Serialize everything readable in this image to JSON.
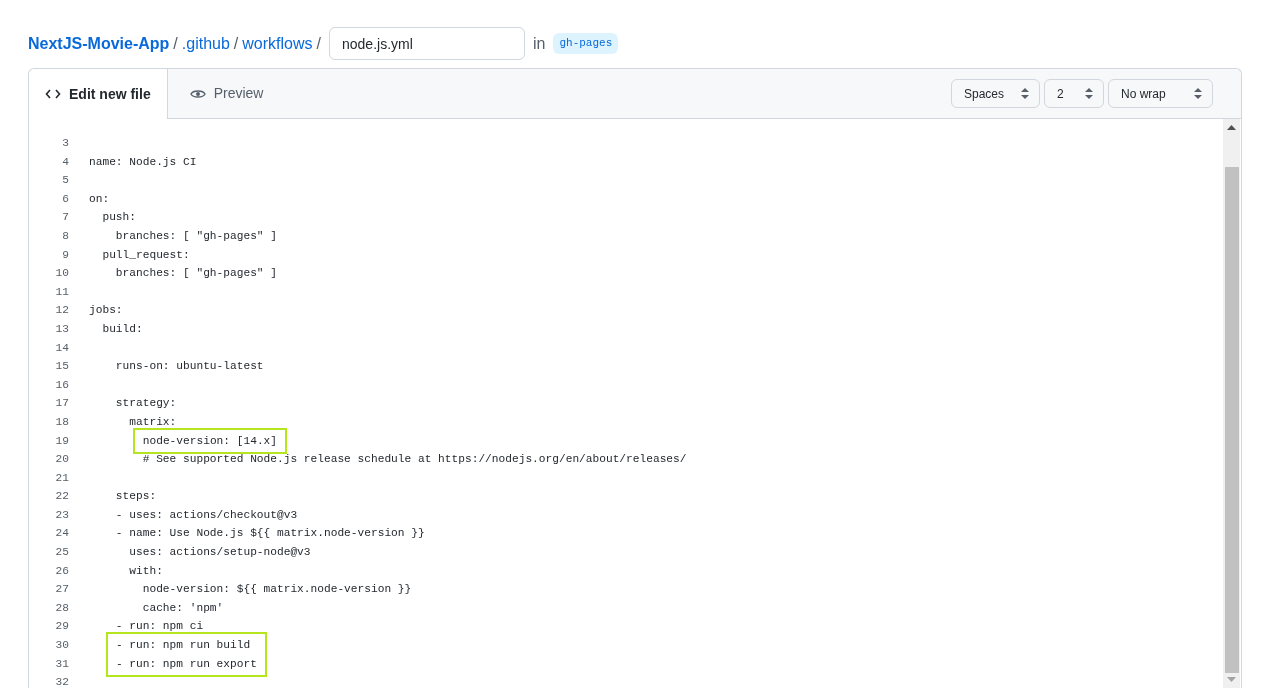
{
  "breadcrumb": {
    "repository": "NextJS-Movie-App",
    "separator": "/",
    "folders": [
      ".github",
      "workflows"
    ],
    "filename": "node.js.yml",
    "branch_prefix": "in",
    "branch": "gh-pages"
  },
  "tabs": [
    {
      "label": "Edit new file",
      "selected": true
    },
    {
      "label": "Preview",
      "selected": false
    }
  ],
  "editor_options": [
    {
      "value": "Spaces"
    },
    {
      "value": "2"
    },
    {
      "value": "No wrap"
    }
  ],
  "code_lines": [
    {
      "number": "3",
      "highlighted": false
    },
    {
      "number": "4",
      "text": "name: Node.js CI",
      "highlighted": false
    },
    {
      "number": "5",
      "highlighted": false
    },
    {
      "number": "6",
      "text": "on:",
      "highlighted": false
    },
    {
      "number": "7",
      "text": "  push:",
      "highlighted": false
    },
    {
      "number": "8",
      "text": "    branches: [ \"gh-pages\" ]",
      "highlighted": false
    },
    {
      "number": "9",
      "text": "  pull_request:",
      "highlighted": false
    },
    {
      "number": "10",
      "text": "    branches: [ \"gh-pages\" ]",
      "highlighted": false
    },
    {
      "number": "11",
      "highlighted": false
    },
    {
      "number": "12",
      "text": "jobs:",
      "highlighted": false
    },
    {
      "number": "13",
      "text": "  build:",
      "highlighted": false
    },
    {
      "number": "14",
      "highlighted": false
    },
    {
      "number": "15",
      "text": "    runs-on: ubuntu-latest",
      "highlighted": false
    },
    {
      "number": "16",
      "highlighted": false
    },
    {
      "number": "17",
      "text": "    strategy:",
      "highlighted": false
    },
    {
      "number": "18",
      "text": "      matrix:",
      "highlighted": false
    },
    {
      "number": "19",
      "text": "        node-version: [14.x]",
      "highlighted": true
    },
    {
      "number": "20",
      "text": "        # See supported Node.js release schedule at https://nodejs.org/en/about/releases/",
      "highlighted": false
    },
    {
      "number": "21",
      "highlighted": false
    },
    {
      "number": "22",
      "text": "    steps:",
      "highlighted": false
    },
    {
      "number": "23",
      "text": "    - uses: actions/checkout@v3",
      "highlighted": false
    },
    {
      "number": "24",
      "text": "    - name: Use Node.js ${{ matrix.node-version }}",
      "highlighted": false
    },
    {
      "number": "25",
      "text": "      uses: actions/setup-node@v3",
      "highlighted": false
    },
    {
      "number": "26",
      "text": "      with:",
      "highlighted": false
    },
    {
      "number": "27",
      "text": "        node-version: ${{ matrix.node-version }}",
      "highlighted": false
    },
    {
      "number": "28",
      "text": "        cache: 'npm'",
      "highlighted": false
    },
    {
      "number": "29",
      "text": "    - run: npm ci",
      "highlighted": false
    },
    {
      "number": "30",
      "text": "    - run: npm run build",
      "highlighted": true
    },
    {
      "number": "31",
      "text": "    - run: npm run export",
      "highlighted": true
    },
    {
      "number": "32",
      "highlighted": false
    }
  ]
}
